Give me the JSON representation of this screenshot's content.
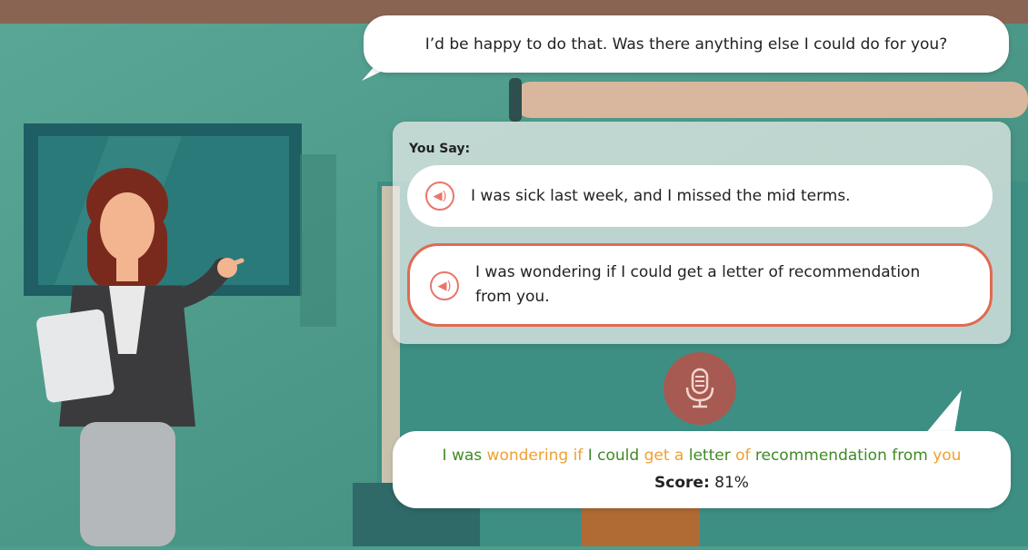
{
  "npc": {
    "speech": "I’d be happy to do that. Was there anything else I could do for you?"
  },
  "prompt_panel": {
    "label": "You Say:",
    "options": [
      {
        "text": "I was sick last week, and I missed the mid terms.",
        "icon": "speaker-icon"
      },
      {
        "text": "I was wondering if I could get a letter of recommendation from you.",
        "icon": "speaker-icon",
        "selected": true
      }
    ]
  },
  "mic": {
    "icon": "microphone-icon"
  },
  "result": {
    "words": [
      {
        "text": "I",
        "status": "good"
      },
      {
        "text": "was",
        "status": "good"
      },
      {
        "text": "wondering",
        "status": "fair"
      },
      {
        "text": "if",
        "status": "fair"
      },
      {
        "text": "I",
        "status": "good"
      },
      {
        "text": "could",
        "status": "good"
      },
      {
        "text": "get",
        "status": "fair"
      },
      {
        "text": "a",
        "status": "fair"
      },
      {
        "text": "letter",
        "status": "good"
      },
      {
        "text": "of",
        "status": "fair"
      },
      {
        "text": "recommendation",
        "status": "good"
      },
      {
        "text": "from",
        "status": "good"
      },
      {
        "text": "you",
        "status": "fair"
      }
    ],
    "score_label": "Score:",
    "score_value": "81%"
  },
  "colors": {
    "good": "#3f8a24",
    "fair": "#efa030",
    "accent": "#e06a52"
  }
}
